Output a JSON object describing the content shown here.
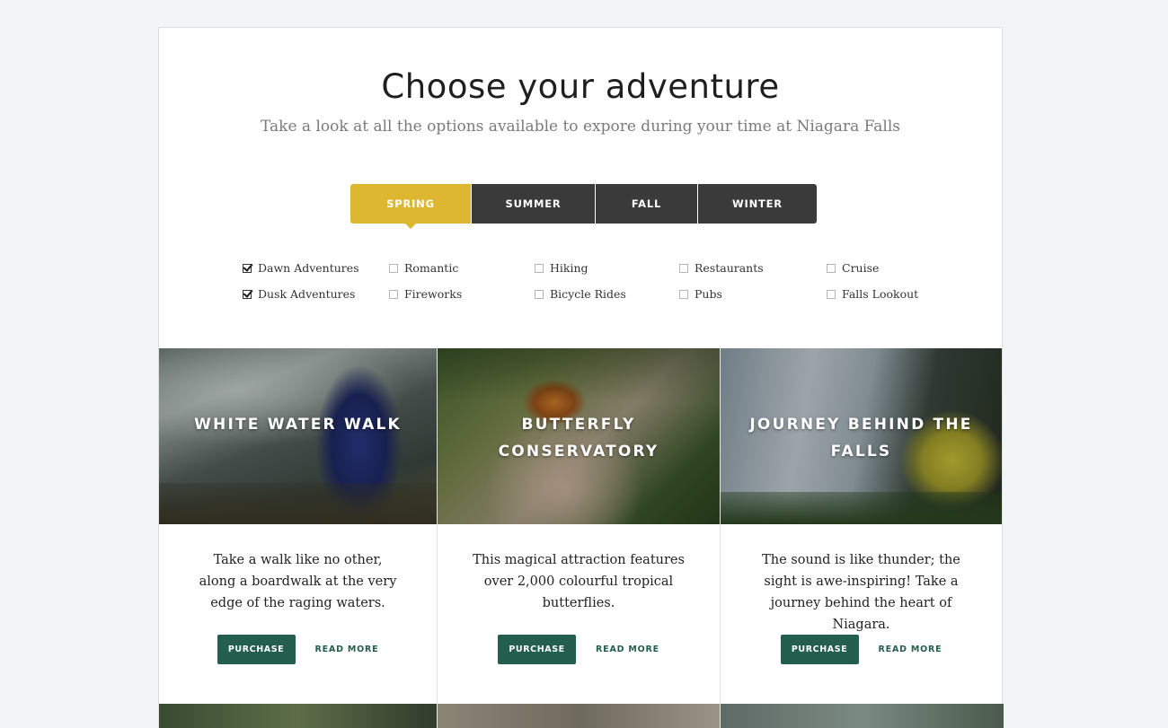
{
  "header": {
    "title": "Choose your adventure",
    "subtitle": "Take a look at all the options available to expore during your time at Niagara Falls"
  },
  "tabs": [
    {
      "label": "SPRING",
      "active": true
    },
    {
      "label": "SUMMER",
      "active": false
    },
    {
      "label": "FALL",
      "active": false
    },
    {
      "label": "WINTER",
      "active": false
    }
  ],
  "filters": [
    {
      "label": "Dawn Adventures",
      "checked": true
    },
    {
      "label": "Dusk Adventures",
      "checked": true
    },
    {
      "label": "Romantic",
      "checked": false
    },
    {
      "label": "Fireworks",
      "checked": false
    },
    {
      "label": "Hiking",
      "checked": false
    },
    {
      "label": "Bicycle Rides",
      "checked": false
    },
    {
      "label": "Restaurants",
      "checked": false
    },
    {
      "label": "Pubs",
      "checked": false
    },
    {
      "label": "Cruise",
      "checked": false
    },
    {
      "label": "Falls Lookout",
      "checked": false
    }
  ],
  "cards": [
    {
      "title": "WHITE WATER WALK",
      "description": "Take a walk like no other, along a boardwalk at the very edge of the raging waters.",
      "purchase_label": "PURCHASE",
      "read_more_label": "READ MORE"
    },
    {
      "title": "BUTTERFLY CONSERVATORY",
      "description": "This magical attraction features over 2,000 colourful tropical butterflies.",
      "purchase_label": "PURCHASE",
      "read_more_label": "READ MORE"
    },
    {
      "title": "JOURNEY BEHIND THE FALLS",
      "description": "The sound is like thunder; the sight is awe-inspiring! Take a journey behind the heart of Niagara.",
      "purchase_label": "PURCHASE",
      "read_more_label": "READ MORE"
    }
  ],
  "colors": {
    "accent_yellow": "#dcb72f",
    "tab_dark": "#3a3a3a",
    "button_green": "#245e4c",
    "page_bg": "#f2f5f8"
  }
}
